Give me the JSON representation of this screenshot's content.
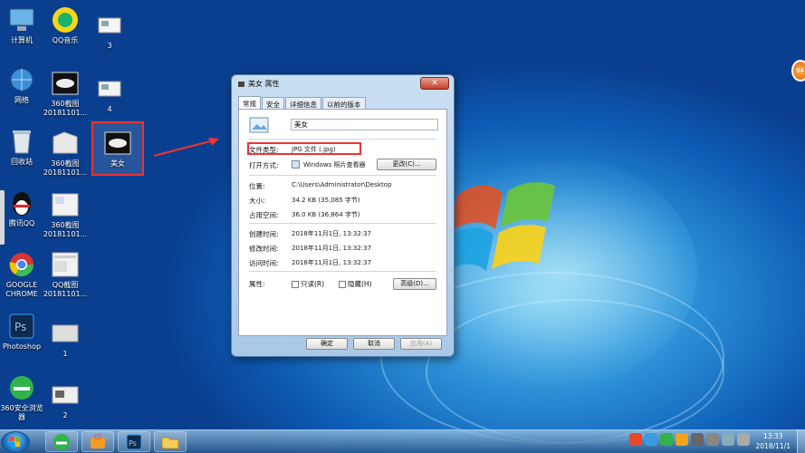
{
  "desktop": {
    "icons": [
      {
        "label": "计算机",
        "icon": "computer-icon"
      },
      {
        "label": "QQ音乐",
        "icon": "qq-music-icon"
      },
      {
        "label": "3",
        "icon": "folder-doc-icon"
      },
      {
        "label": "网络",
        "icon": "network-icon"
      },
      {
        "label": "360截图\n20181101...",
        "icon": "screenshot-file-icon"
      },
      {
        "label": "4",
        "icon": "folder-doc-icon"
      },
      {
        "label": "回收站",
        "icon": "recycle-bin-icon"
      },
      {
        "label": "360截图\n20181101...",
        "icon": "screenshot-file-icon"
      },
      {
        "label": "美女",
        "icon": "image-file-icon"
      },
      {
        "label": "腾讯QQ",
        "icon": "qq-penguin-icon"
      },
      {
        "label": "360截图\n20181101...",
        "icon": "screenshot-file-icon"
      },
      {
        "label": "GOOGLE\nCHROME",
        "icon": "chrome-icon"
      },
      {
        "label": "QQ截图\n20181101...",
        "icon": "screenshot-file-icon"
      },
      {
        "label": "Photoshop",
        "icon": "photoshop-icon"
      },
      {
        "label": "1",
        "icon": "image-file-icon"
      },
      {
        "label": "360安全浏览\n器",
        "icon": "360-browser-icon"
      },
      {
        "label": "2",
        "icon": "image-file-icon"
      }
    ]
  },
  "dialog": {
    "title": "美女 属性",
    "close_glyph": "✕",
    "tabs": [
      "常规",
      "安全",
      "详细信息",
      "以前的版本"
    ],
    "filename": "美女",
    "file_type_label": "文件类型:",
    "file_type_value": "JPG 文件 (.jpg)",
    "open_with_label": "打开方式:",
    "open_with_value": "Windows 照片查看器",
    "change_button": "更改(C)...",
    "location_label": "位置:",
    "location_value": "C:\\Users\\Administrator\\Desktop",
    "size_label": "大小:",
    "size_value": "34.2 KB (35,085 字节)",
    "disk_size_label": "占用空间:",
    "disk_size_value": "36.0 KB (36,864 字节)",
    "created_label": "创建时间:",
    "created_value": "2018年11月1日, 13:32:37",
    "modified_label": "修改时间:",
    "modified_value": "2018年11月1日, 13:32:37",
    "accessed_label": "访问时间:",
    "accessed_value": "2018年11月1日, 13:32:37",
    "attributes_label": "属性:",
    "readonly_label": "只读(R)",
    "hidden_label": "隐藏(H)",
    "advanced_button": "高级(D)...",
    "ok_button": "确定",
    "cancel_button": "取消",
    "apply_button": "应用(A)"
  },
  "taskbar": {
    "clock_time": "13:33",
    "clock_date": "2018/11/1"
  },
  "floating_badge": "84"
}
